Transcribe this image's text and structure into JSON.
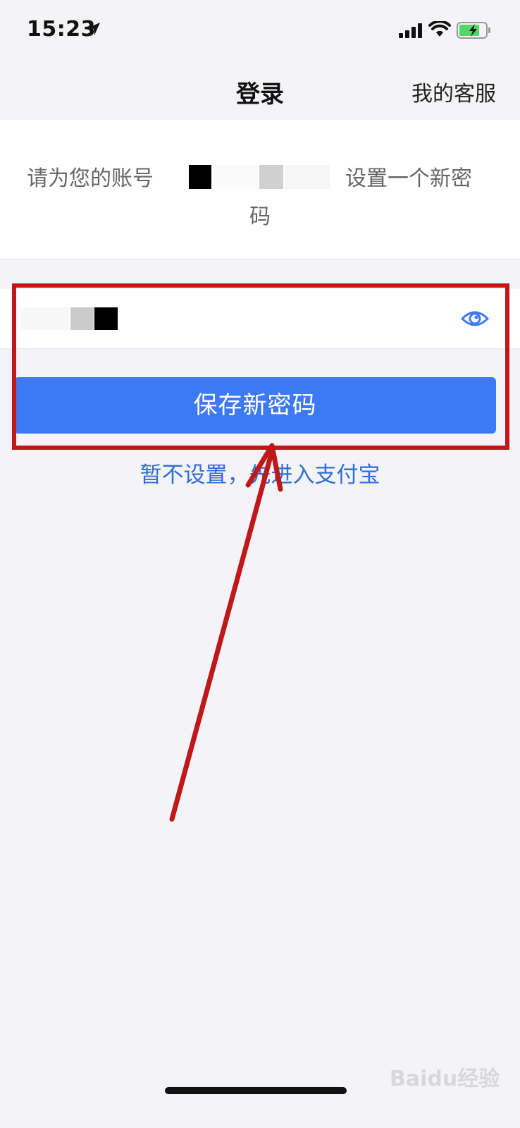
{
  "status_bar": {
    "time": "15:23",
    "icons": [
      "location-arrow-icon",
      "signal-icon",
      "wifi-icon",
      "battery-charging-icon"
    ]
  },
  "nav": {
    "title": "登录",
    "action": "我的客服"
  },
  "prompt": {
    "line1_start": "请为您的账号",
    "line1_end": "设置一个新密",
    "line2": "码"
  },
  "password_field": {
    "toggle_icon": "eye-icon"
  },
  "save_button": {
    "label": "保存新密码"
  },
  "skip_link": {
    "label": "暂不设置，先进入支付宝"
  },
  "watermark": {
    "text": "Baidu经验"
  },
  "colors": {
    "primary": "#3d79f2",
    "link": "#2f6fd6",
    "annotation": "#c01818",
    "background": "#f4f3f8"
  }
}
